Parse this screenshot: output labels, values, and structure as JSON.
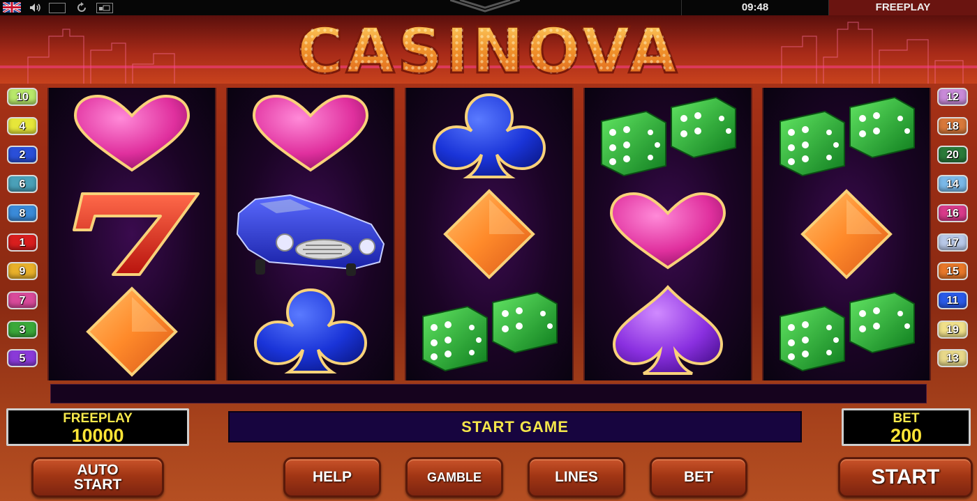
{
  "topbar": {
    "clock": "09:48",
    "mode": "FREEPLAY"
  },
  "logo": {
    "text": "CASINOVA"
  },
  "reels": [
    [
      "heart",
      "seven",
      "diamond"
    ],
    [
      "heart",
      "car",
      "club"
    ],
    [
      "club",
      "diamond",
      "dice"
    ],
    [
      "dice",
      "heart",
      "spade"
    ],
    [
      "dice",
      "diamond",
      "dice"
    ]
  ],
  "paylines": {
    "left": [
      {
        "n": "10",
        "color": "#b8e86a"
      },
      {
        "n": "4",
        "color": "#e6e63a"
      },
      {
        "n": "2",
        "color": "#2a4fd8"
      },
      {
        "n": "6",
        "color": "#4aa0b8"
      },
      {
        "n": "8",
        "color": "#3a8ad8"
      },
      {
        "n": "1",
        "color": "#d81e1e"
      },
      {
        "n": "9",
        "color": "#e8b02a"
      },
      {
        "n": "7",
        "color": "#d84a9a"
      },
      {
        "n": "3",
        "color": "#3aa83a"
      },
      {
        "n": "5",
        "color": "#8a3ad8"
      }
    ],
    "right": [
      {
        "n": "12",
        "color": "#c88ad8"
      },
      {
        "n": "18",
        "color": "#d8783a"
      },
      {
        "n": "20",
        "color": "#2a7a3a"
      },
      {
        "n": "14",
        "color": "#7ab8e8"
      },
      {
        "n": "16",
        "color": "#d83a8a"
      },
      {
        "n": "17",
        "color": "#b8c8e8"
      },
      {
        "n": "15",
        "color": "#e8782a"
      },
      {
        "n": "11",
        "color": "#2a5ae8"
      },
      {
        "n": "19",
        "color": "#f0e08a"
      },
      {
        "n": "13",
        "color": "#e8d88a"
      }
    ]
  },
  "balance": {
    "label": "FREEPLAY",
    "value": "10000"
  },
  "message": "START GAME",
  "bet_display": {
    "label": "BET",
    "value": "200"
  },
  "buttons": {
    "auto_start_line1": "AUTO",
    "auto_start_line2": "START",
    "help": "HELP",
    "gamble": "GAMBLE",
    "lines": "LINES",
    "bet": "BET",
    "start": "START"
  }
}
